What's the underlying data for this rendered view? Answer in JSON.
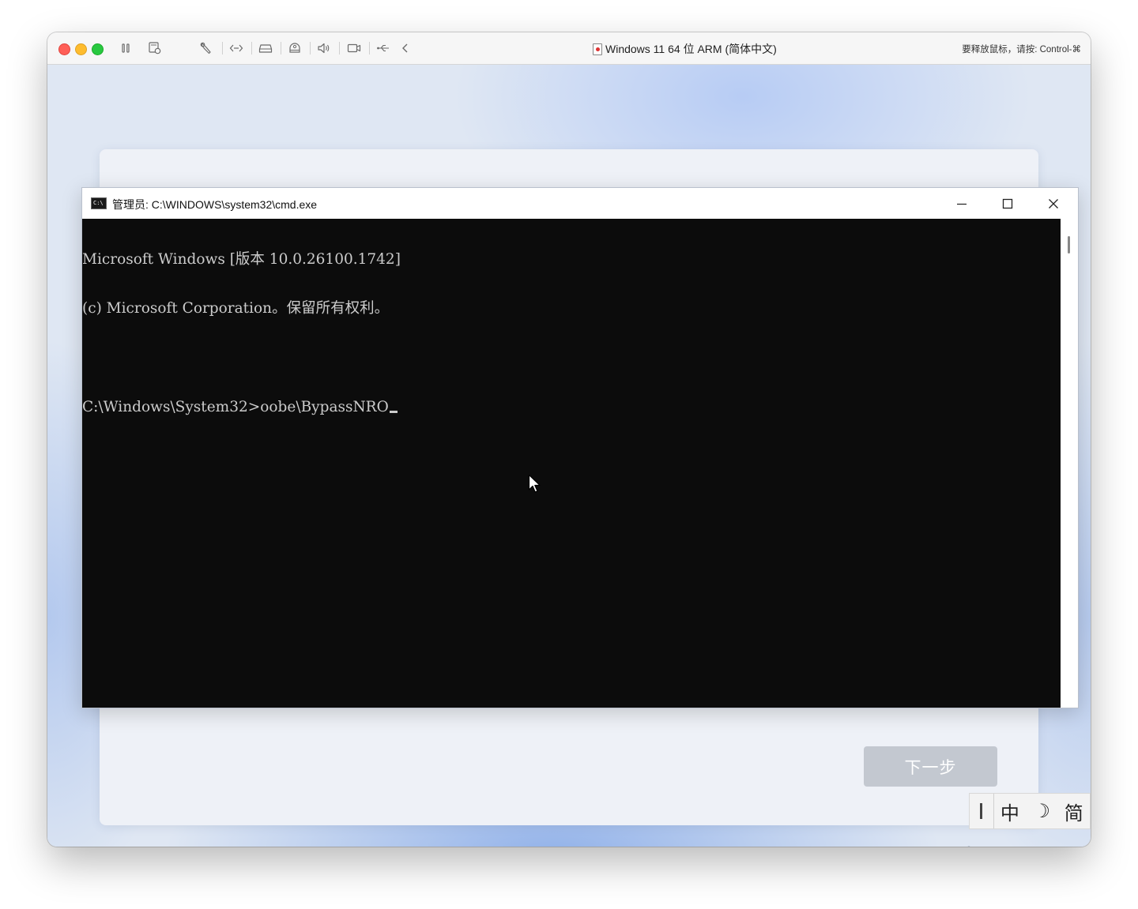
{
  "vm_window": {
    "title": "Windows 11 64 位 ARM (简体中文)",
    "release_hint": "要释放鼠标，请按: Control-⌘",
    "toolbar_icons": [
      "pause-icon",
      "snapshot-icon",
      "settings-wrench-icon",
      "code-icon",
      "disk-icon",
      "printer-icon",
      "volume-icon",
      "camera-icon",
      "usb-icon",
      "chevron-left-icon"
    ]
  },
  "cmd": {
    "title": "管理员: C:\\WINDOWS\\system32\\cmd.exe",
    "lines": [
      "Microsoft Windows [版本 10.0.26100.1742]",
      "(c) Microsoft Corporation。保留所有权利。",
      "",
      "C:\\Windows\\System32>oobe\\BypassNRO"
    ]
  },
  "oobe": {
    "next_label": "下一步"
  },
  "ime": {
    "mode": "中",
    "width_mode": "☽",
    "script": "简"
  },
  "colors": {
    "console_bg": "#0c0c0c",
    "console_text": "#cccccc",
    "next_button_bg": "#c3c8d0"
  }
}
